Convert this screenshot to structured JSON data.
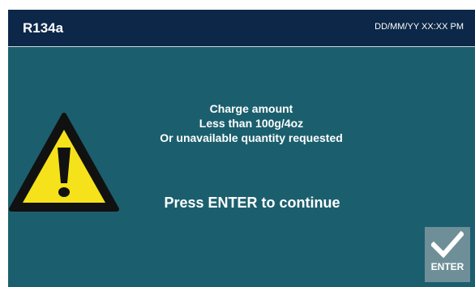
{
  "header": {
    "title": "R134a",
    "datetime": "DD/MM/YY XX:XX PM"
  },
  "message": {
    "line1": "Charge amount",
    "line2": "Less than 100g/4oz",
    "line3": "Or unavailable quantity requested"
  },
  "prompt": "Press ENTER to continue",
  "enter_button": {
    "label": "ENTER",
    "icon": "checkmark-icon"
  },
  "warning_icon": "warning-triangle-icon",
  "colors": {
    "header_bg": "#0c2748",
    "screen_bg": "#1b5f6e",
    "warning_yellow": "#f5e21a",
    "button_bg": "#6f8f98"
  }
}
